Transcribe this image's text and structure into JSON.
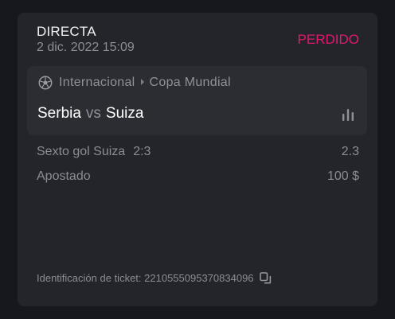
{
  "bet": {
    "type": "DIRECTA",
    "date": "2 dic. 2022 15:09",
    "status": "PERDIDO",
    "status_color": "#e0196d"
  },
  "event": {
    "sport_icon": "soccer-ball-icon",
    "category": "Internacional",
    "tournament": "Copa Mundial",
    "home_team": "Serbia",
    "vs_label": "vs",
    "away_team": "Suiza",
    "stats_icon": "bar-chart-icon"
  },
  "selection": {
    "market": "Sexto gol Suiza",
    "score": "2:3",
    "odds": "2.3"
  },
  "stake": {
    "label": "Apostado",
    "amount": "100 $"
  },
  "ticket": {
    "label": "Identificación de ticket:",
    "id": "2210555095370834096",
    "copy_icon": "copy-icon"
  }
}
